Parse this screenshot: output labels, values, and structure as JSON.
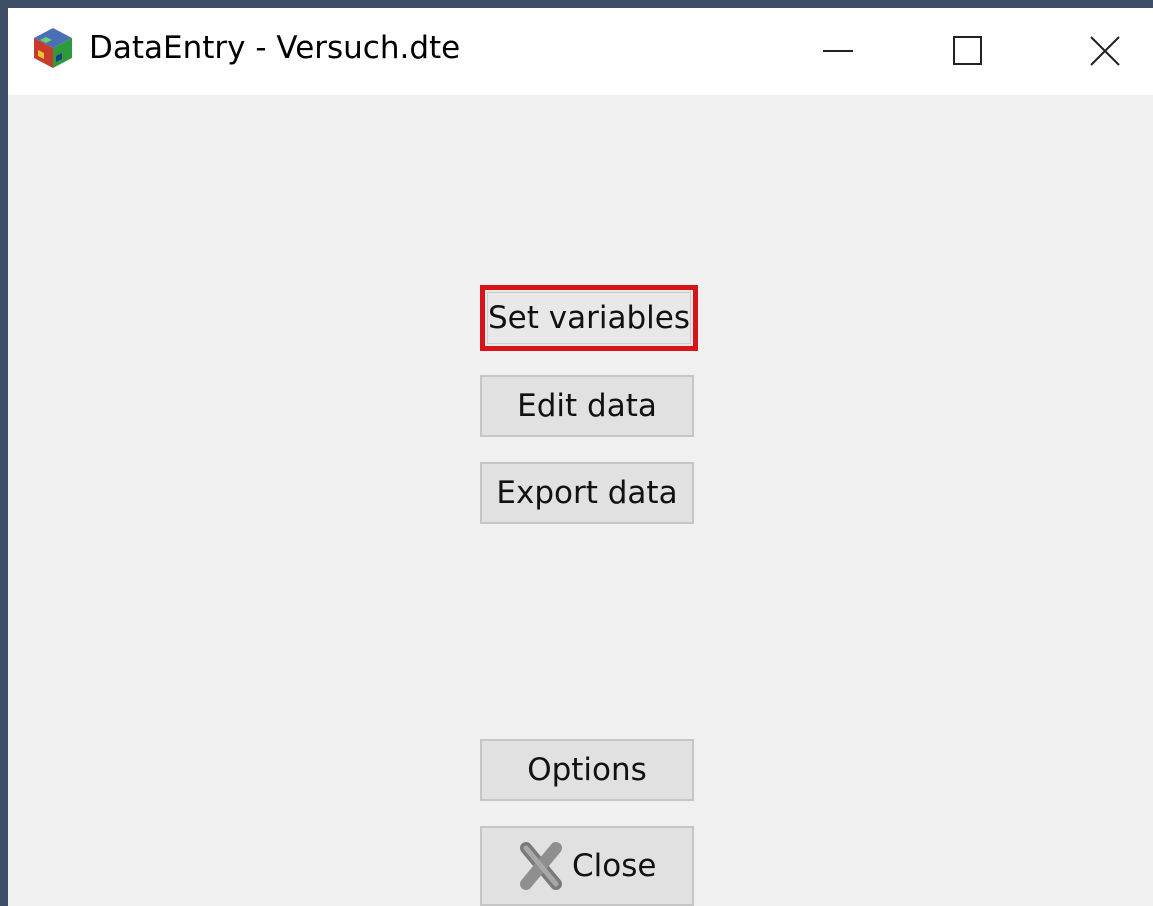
{
  "window": {
    "title": "DataEntry - Versuch.dte",
    "app_icon": "cube-icon",
    "controls": [
      "minimize-icon",
      "maximize-icon",
      "close-icon"
    ]
  },
  "buttons": {
    "set_variables": "Set variables",
    "edit_data": "Edit data",
    "export_data": "Export data",
    "options": "Options",
    "close": "Close"
  },
  "highlight": {
    "target": "set_variables",
    "color": "#d7141a"
  },
  "colors": {
    "desktop": "#3e4e66",
    "window_bg": "#f0f0f0",
    "button_bg": "#e1e1e1"
  }
}
